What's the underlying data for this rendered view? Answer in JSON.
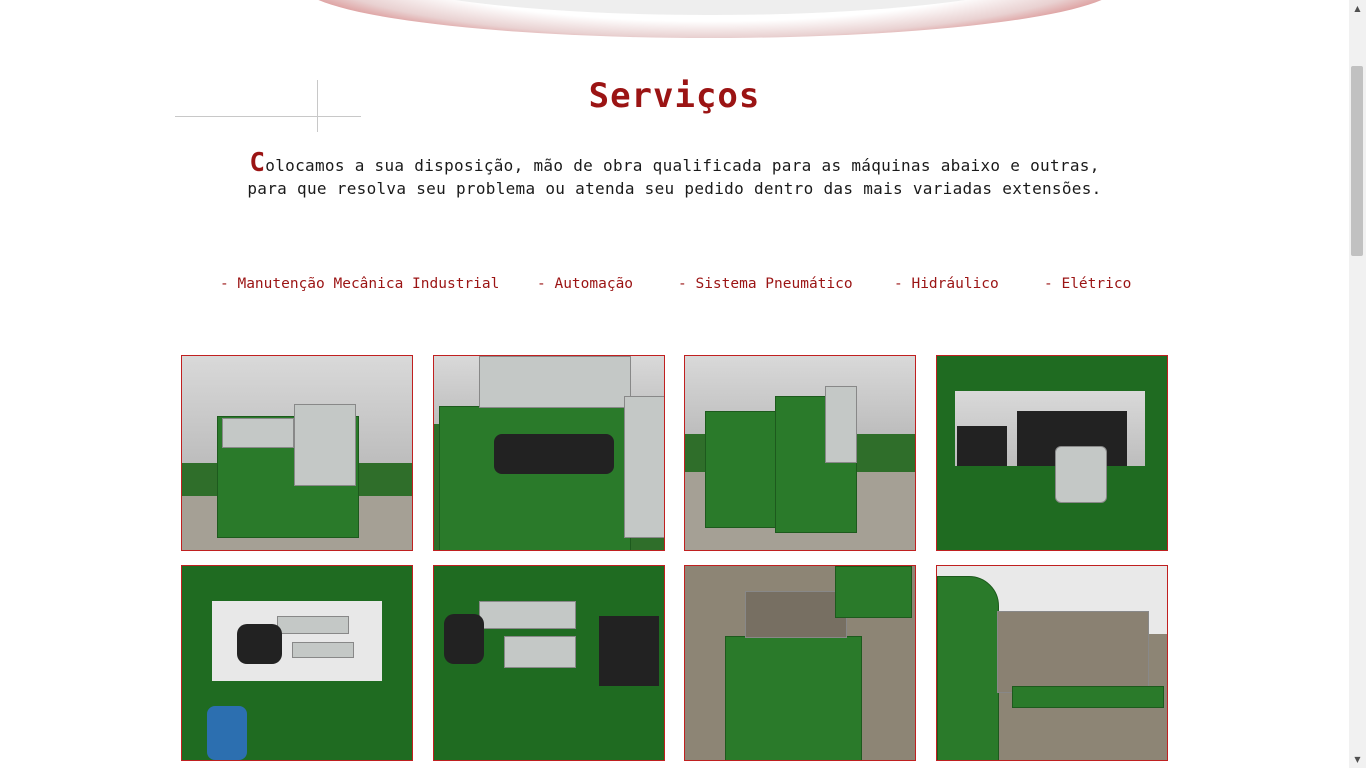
{
  "page": {
    "title": "Serviços",
    "intro_dropcap": "C",
    "intro_line1_rest": "olocamos a sua disposição, mão de obra qualificada para as máquinas abaixo e outras,",
    "intro_line2": "para que resolva seu problema ou atenda seu pedido dentro das mais variadas extensões."
  },
  "services": [
    "- Manutenção Mecânica Industrial",
    "- Automação",
    "- Sistema Pneumático",
    "- Hidráulico",
    "- Elétrico"
  ],
  "photos": {
    "count": 8,
    "subject": "green industrial machines"
  },
  "colors": {
    "accent": "#9b1414",
    "machine_green": "#2a7a2a",
    "photo_border": "#c02020"
  },
  "scrollbar": {
    "up_icon": "▲",
    "down_icon": "▼"
  }
}
